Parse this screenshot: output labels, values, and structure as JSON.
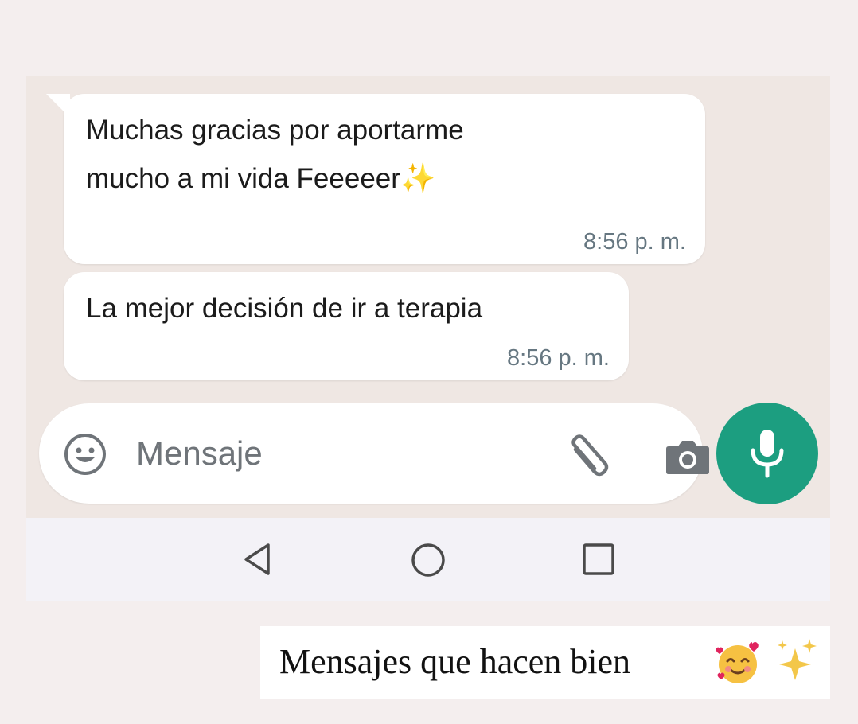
{
  "chat": {
    "messages": [
      {
        "lines": [
          "Muchas gracias por aportarme",
          "mucho a mi vida Feeeeer"
        ],
        "emoji": "✨",
        "time": "8:56 p. m."
      },
      {
        "lines": [
          "La mejor decisión de ir a terapia"
        ],
        "time": "8:56 p. m."
      }
    ]
  },
  "composer": {
    "placeholder": "Mensaje",
    "icons": [
      "emoji-icon",
      "paperclip-icon",
      "camera-icon",
      "microphone-icon"
    ]
  },
  "navbar": {
    "icons": [
      "back-triangle-icon",
      "home-circle-icon",
      "recents-square-icon"
    ]
  },
  "caption": {
    "text": "Mensajes que hacen bien",
    "emoji": [
      "smiling-face-with-hearts-icon",
      "sparkles-icon"
    ]
  },
  "colors": {
    "mic_button": "#1c9e80",
    "bubble": "#ffffff",
    "timestamp": "#667781"
  }
}
